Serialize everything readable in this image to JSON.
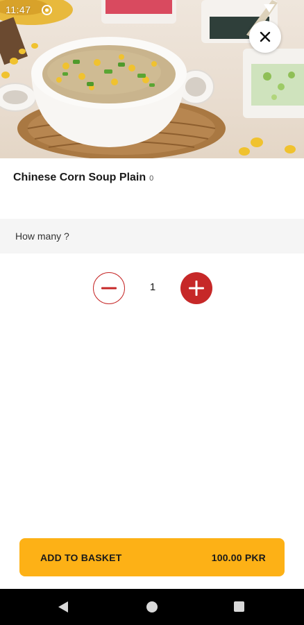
{
  "status_bar": {
    "time": "11:47"
  },
  "item": {
    "title": "Chinese Corn Soup Plain",
    "title_suffix": "0"
  },
  "quantity": {
    "prompt": "How many ?",
    "value": "1"
  },
  "basket": {
    "label": "ADD TO BASKET",
    "price": "100.00 PKR"
  },
  "colors": {
    "accent_red": "#c62828",
    "basket_yellow": "#fdb116",
    "section_gray": "#f5f5f5",
    "nav_black": "#000000"
  },
  "icons": {
    "close": "close-icon",
    "minus": "minus-icon",
    "plus": "plus-icon",
    "nav_back": "back-triangle-icon",
    "nav_home": "home-circle-icon",
    "nav_recents": "recents-square-icon"
  }
}
